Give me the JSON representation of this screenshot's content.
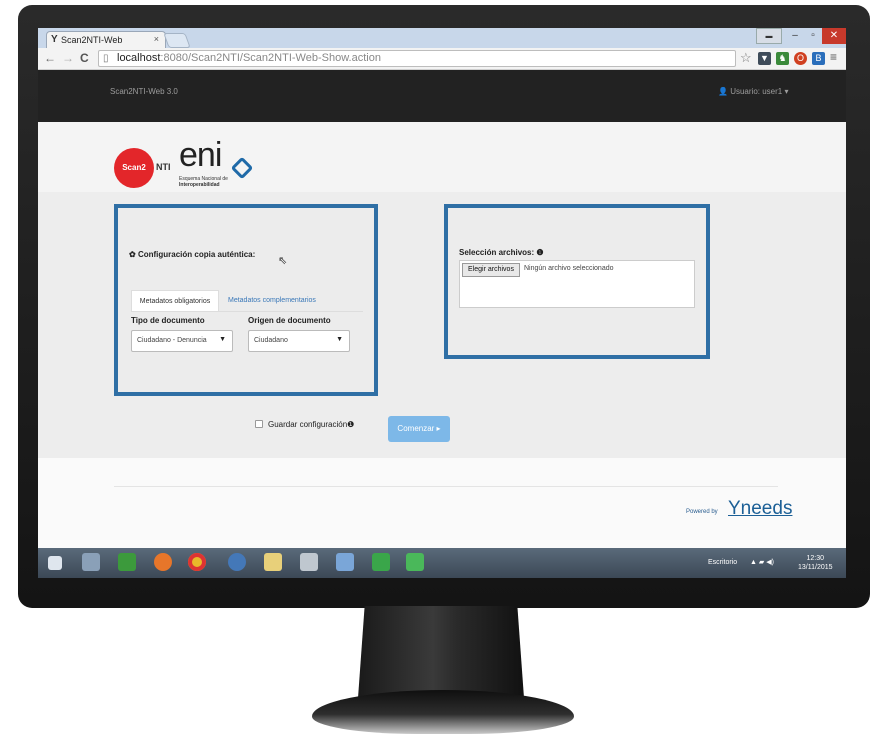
{
  "browser": {
    "tab_title": "Scan2NTI-Web",
    "tab_close": "×",
    "url_host": "localhost",
    "url_rest": ":8080/Scan2NTI/Scan2NTI-Web-Show.action",
    "back": "←",
    "forward": "→",
    "reload": "C",
    "star": "☆"
  },
  "navbar": {
    "brand": "Scan2NTI-Web 3.0",
    "user": "Usuario: user1 ▾"
  },
  "logos": {
    "scan2nti": "Scan2",
    "scan2nti_suffix": "NTI",
    "eni": "eni",
    "eni_sub1": "Esquema Nacional de",
    "eni_sub2": "Interoperabilidad"
  },
  "config": {
    "title": "Configuración copia auténtica:",
    "tab_obligatorios": "Metadatos obligatorios",
    "tab_complementarios": "Metadatos complementarios",
    "tipo_label": "Tipo de documento",
    "tipo_value": "Ciudadano - Denuncia",
    "origen_label": "Origen de documento",
    "origen_value": "Ciudadano"
  },
  "files": {
    "title": "Selección archivos:",
    "button": "Elegir archivos",
    "status": "Ningún archivo seleccionado"
  },
  "actions": {
    "guardar": "Guardar configuración",
    "comenzar": "Comenzar ▸"
  },
  "footer": {
    "powered": "Powered by",
    "brand": "Yneeds"
  },
  "taskbar": {
    "escritorio": "Escritorio",
    "time": "12:30",
    "date": "13/11/2015"
  },
  "colors": {
    "highlight_border": "#2f6fa5",
    "navbar_bg": "#222222",
    "button_primary": "#7db8e8"
  }
}
